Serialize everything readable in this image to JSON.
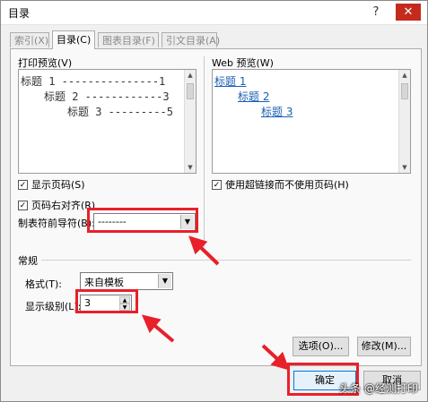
{
  "window": {
    "title": "目录",
    "help_icon": "question-mark-icon",
    "close_icon": "close-icon"
  },
  "tabs": [
    {
      "label": "索引(X)",
      "active": false
    },
    {
      "label": "目录(C)",
      "active": true
    },
    {
      "label": "图表目录(F)",
      "active": false
    },
    {
      "label": "引文目录(A)",
      "active": false
    }
  ],
  "print_preview": {
    "label": "打印预览(V)",
    "lines": [
      "标题 1 ---------------1",
      "标题 2 ------------3",
      "标题 3 ---------5"
    ]
  },
  "web_preview": {
    "label": "Web 预览(W)",
    "links": [
      "标题 1",
      "标题 2",
      "标题 3"
    ]
  },
  "options": {
    "show_page_numbers": {
      "label": "显示页码(S)",
      "checked": true
    },
    "right_align": {
      "label": "页码右对齐(R)",
      "checked": true
    },
    "tab_leader": {
      "label": "制表符前导符(B):",
      "value": "--------"
    },
    "use_hyperlinks": {
      "label": "使用超链接而不使用页码(H)",
      "checked": true
    }
  },
  "general": {
    "section_label": "常规",
    "format": {
      "label": "格式(T):",
      "value": "来自模板"
    },
    "levels": {
      "label": "显示级别(L):",
      "value": "3"
    }
  },
  "buttons": {
    "options": "选项(O)...",
    "modify": "修改(M)...",
    "ok": "确定",
    "cancel": "取消"
  },
  "watermark": "头条 @经测打印",
  "colors": {
    "highlight": "#e8202a",
    "link": "#1a5fb4",
    "close": "#c42b1c"
  }
}
